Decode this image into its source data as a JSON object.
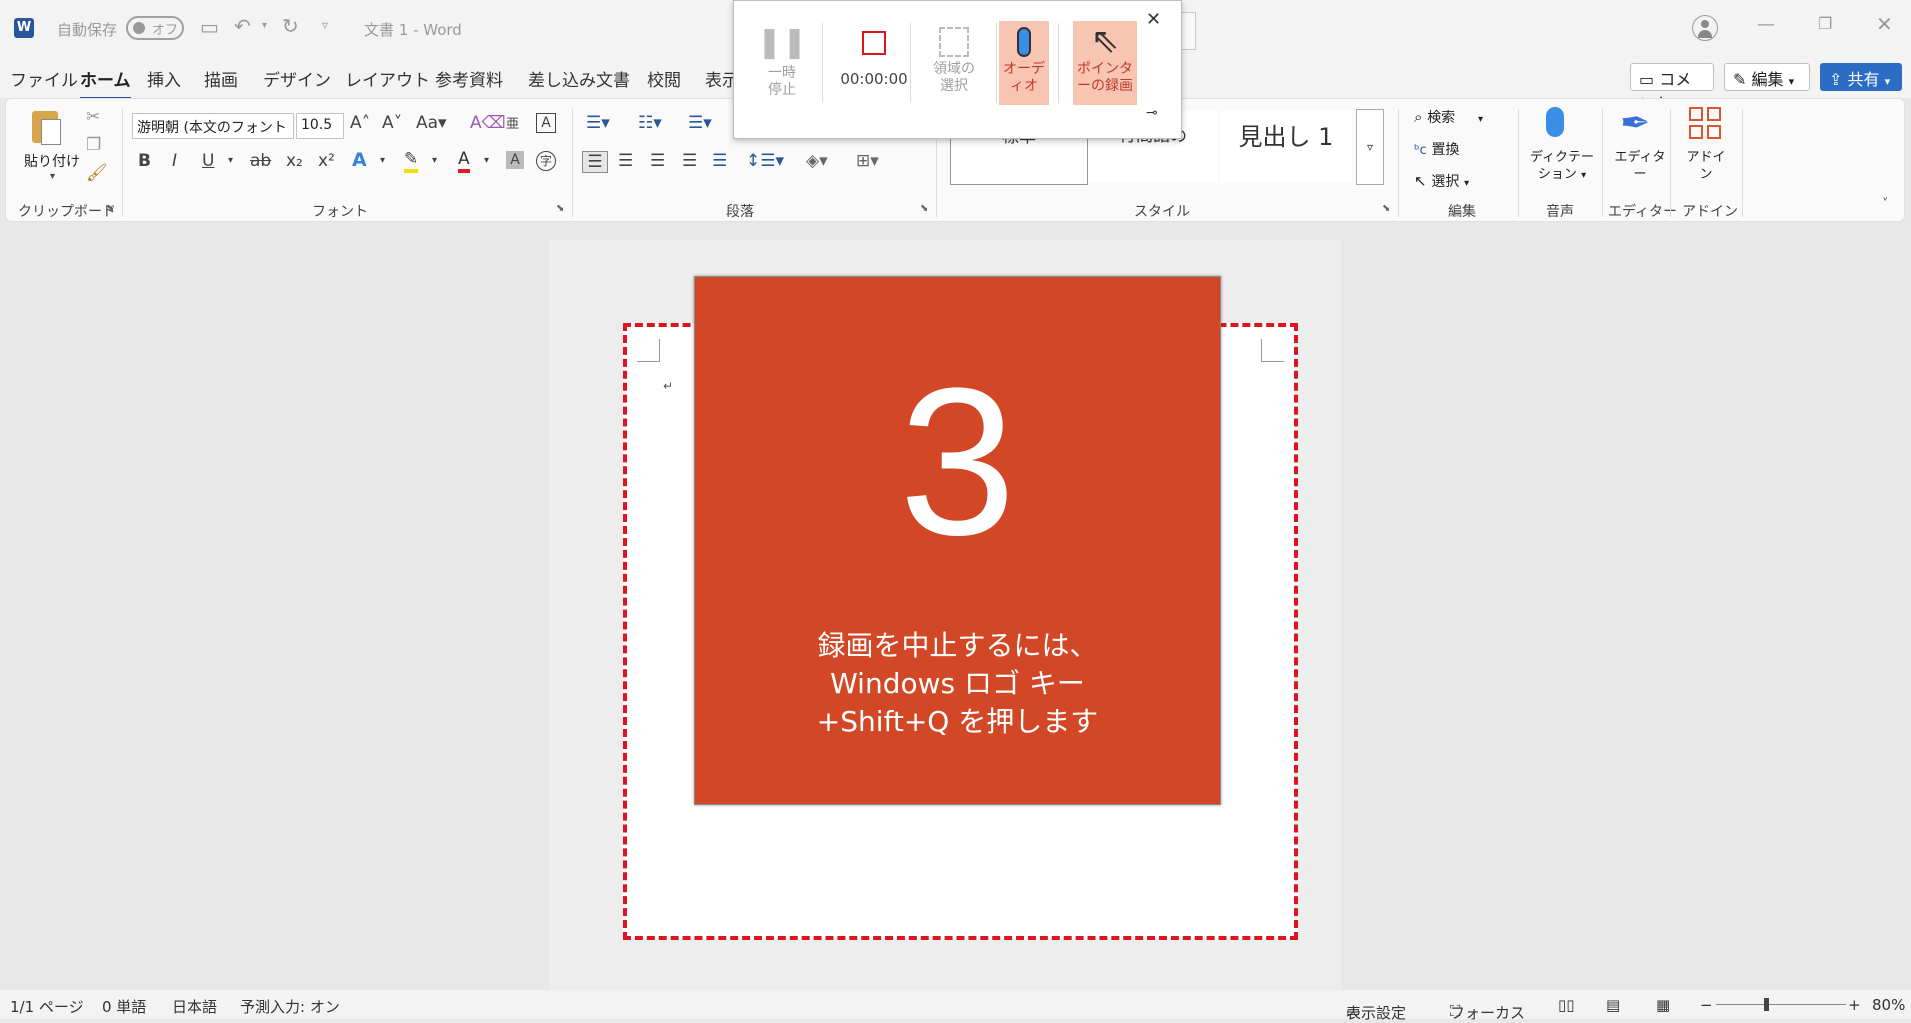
{
  "titlebar": {
    "autosave_label": "自動保存",
    "autosave_state": "オフ",
    "doc_title": "文書 1 - Word"
  },
  "tabs": [
    "ファイル",
    "ホーム",
    "挿入",
    "描画",
    "デザイン",
    "レイアウト",
    "参考資料",
    "差し込み文書",
    "校閲",
    "表示"
  ],
  "top_buttons": {
    "comment": "コメント",
    "edit": "編集",
    "share": "共有"
  },
  "ribbon": {
    "clipboard": {
      "paste": "貼り付け",
      "group": "クリップボード"
    },
    "font": {
      "font_name": "游明朝 (本文のフォント",
      "font_size": "10.5",
      "group": "フォント"
    },
    "paragraph": {
      "group": "段落"
    },
    "styles": {
      "items": [
        "標準",
        "行間詰め",
        "見出し 1"
      ],
      "group": "スタイル"
    },
    "editing": {
      "find": "検索",
      "replace": "置換",
      "select": "選択",
      "group": "編集"
    },
    "voice": {
      "dictate": "ディクテーション",
      "group": "音声"
    },
    "editor": {
      "label": "エディター",
      "group": "エディター"
    },
    "addin": {
      "label": "アドイン",
      "group": "アドイン"
    }
  },
  "recorder": {
    "pause": "一時停止",
    "timer": "00:00:00",
    "select_region": "領域の選択",
    "audio": "オーディオ",
    "pointer": "ポインターの録画"
  },
  "countdown": {
    "number": "3",
    "message_line1": "録画を中止するには、",
    "message_line2": "Windows ロゴ キー",
    "message_line3": "+Shift+Q を押します"
  },
  "statusbar": {
    "page": "1/1 ページ",
    "words": "0 単語",
    "language": "日本語",
    "predict": "予測入力: オン",
    "display_settings": "表示設定",
    "focus": "フォーカス",
    "zoom": "80%"
  }
}
